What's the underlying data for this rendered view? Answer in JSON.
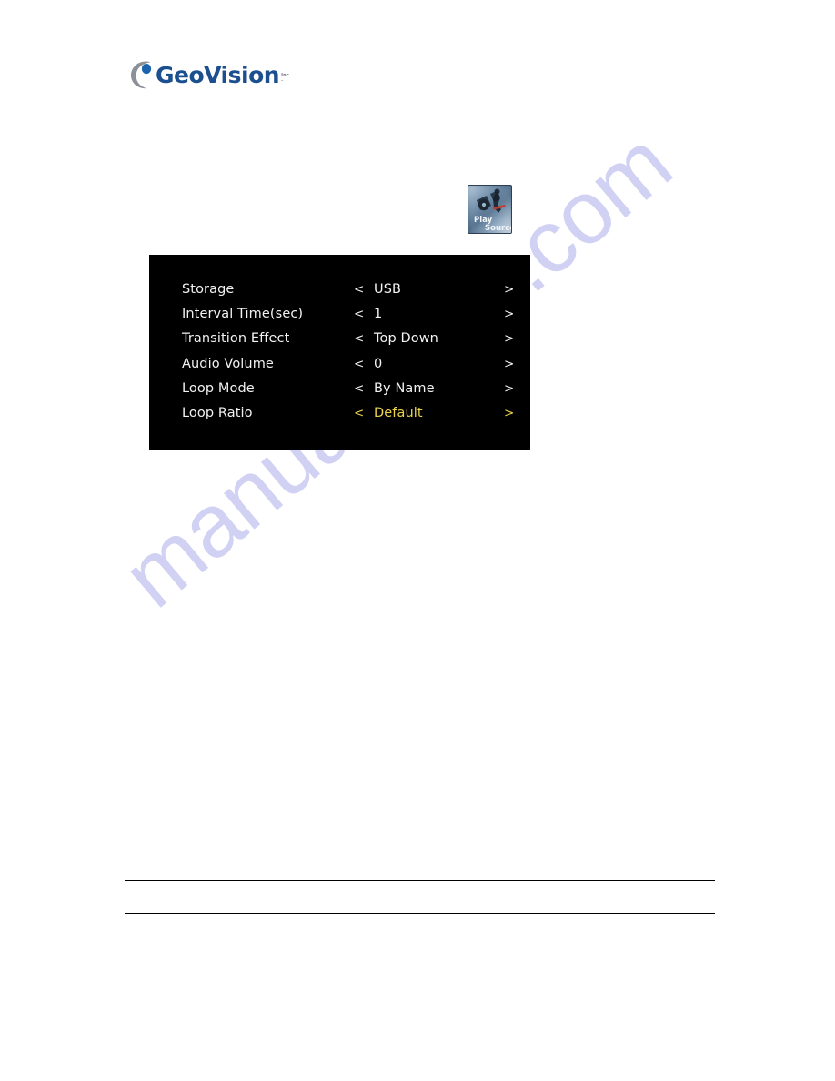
{
  "page": {
    "background_color": "#ffffff",
    "watermark": {
      "text": "manualshive.com",
      "color": "#c9c9f2"
    }
  },
  "logo": {
    "name": "GeoVision",
    "wordmark": "GeoVision",
    "suffix_line1": "Inc",
    "suffix_line2": ".",
    "text_color": "#1b4f8f",
    "mark_color": "#8c9097",
    "dot_color": "#1b63ad"
  },
  "icon": {
    "name": "play-source-icon",
    "caption_line1": "Play",
    "caption_line2": "Source",
    "border_color": "#2b4057"
  },
  "osd_menu": {
    "background_color": "#000000",
    "text_color": "#f2f2f2",
    "highlight_color": "#ecd44a",
    "arrow_left": "<",
    "arrow_right": ">",
    "rows": [
      {
        "label": "Storage",
        "value": "USB",
        "selected": false
      },
      {
        "label": "Interval Time(sec)",
        "value": "1",
        "selected": false
      },
      {
        "label": "Transition Effect",
        "value": "Top Down",
        "selected": false
      },
      {
        "label": "Audio Volume",
        "value": "0",
        "selected": false
      },
      {
        "label": "Loop Mode",
        "value": "By Name",
        "selected": false
      },
      {
        "label": "Loop Ratio",
        "value": "Default",
        "selected": true
      }
    ]
  },
  "footer": {
    "rule_color": "#000000",
    "rule_count": 2
  }
}
